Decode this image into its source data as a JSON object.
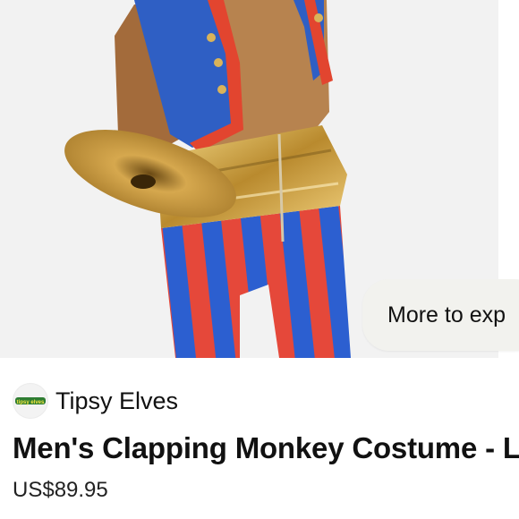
{
  "product_image": {
    "alt_subject": "monkey-costume-photo",
    "colors": {
      "background": "#f2f2f2",
      "vest_blue": "#2f5fc4",
      "trim_red": "#e2452f",
      "fur": "#a06a3c",
      "gold": "#caa04a",
      "stripe_red": "#e5483a",
      "stripe_blue": "#2c5fd0"
    }
  },
  "more_button": {
    "label": "More to exp"
  },
  "seller": {
    "name": "Tipsy Elves",
    "logo_text": "tipsy elves"
  },
  "product": {
    "title": "Men's Clapping Monkey Costume - L",
    "price": "US$89.95"
  }
}
